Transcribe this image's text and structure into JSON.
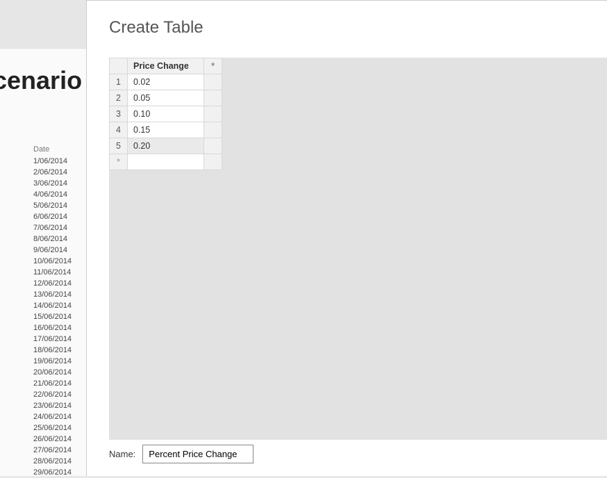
{
  "background": {
    "partial_title": "cenario",
    "date_header": "Date",
    "dates": [
      "1/06/2014",
      "2/06/2014",
      "3/06/2014",
      "4/06/2014",
      "5/06/2014",
      "6/06/2014",
      "7/06/2014",
      "8/06/2014",
      "9/06/2014",
      "10/06/2014",
      "11/06/2014",
      "12/06/2014",
      "13/06/2014",
      "14/06/2014",
      "15/06/2014",
      "16/06/2014",
      "17/06/2014",
      "18/06/2014",
      "19/06/2014",
      "20/06/2014",
      "21/06/2014",
      "22/06/2014",
      "23/06/2014",
      "24/06/2014",
      "25/06/2014",
      "26/06/2014",
      "27/06/2014",
      "28/06/2014",
      "29/06/2014"
    ]
  },
  "dialog": {
    "title": "Create Table",
    "table": {
      "column_header": "Price Change",
      "add_col_header": "*",
      "rows": [
        {
          "num": "1",
          "value": "0.02"
        },
        {
          "num": "2",
          "value": "0.05"
        },
        {
          "num": "3",
          "value": "0.10"
        },
        {
          "num": "4",
          "value": "0.15"
        },
        {
          "num": "5",
          "value": "0.20"
        }
      ],
      "new_row_marker": "*"
    },
    "name_label": "Name:",
    "name_value": "Percent Price Change"
  }
}
